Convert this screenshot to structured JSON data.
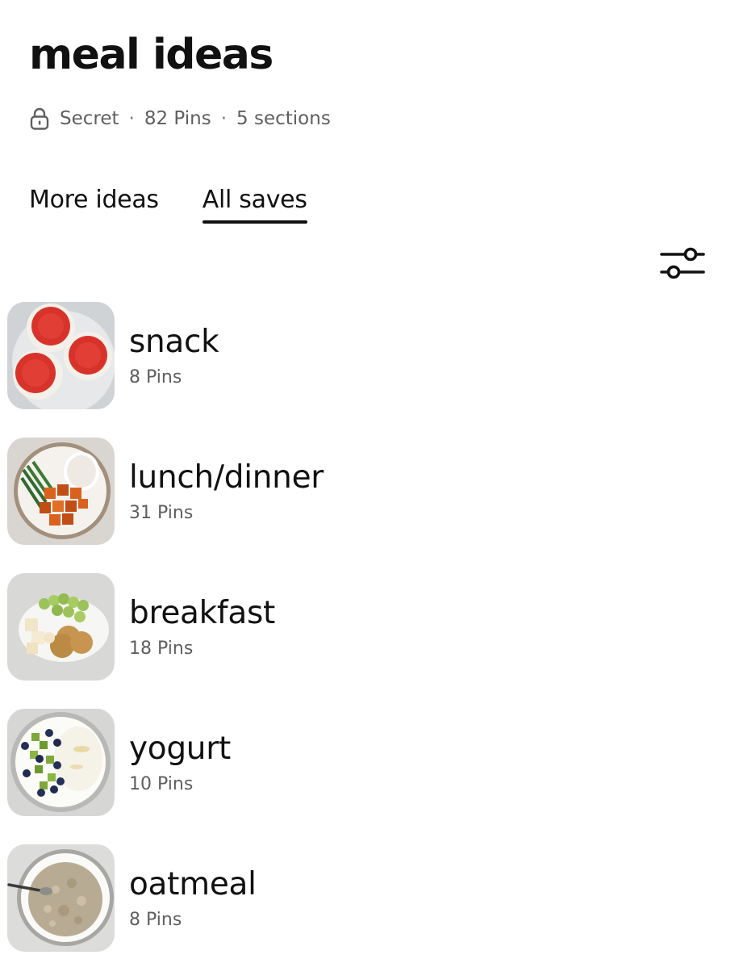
{
  "board": {
    "title": "meal ideas",
    "privacy_icon": "lock-icon",
    "privacy": "Secret",
    "pins": "82 Pins",
    "sections_count": "5 sections"
  },
  "tabs": [
    {
      "label": "More ideas",
      "active": false
    },
    {
      "label": "All saves",
      "active": true
    }
  ],
  "toolbar": {
    "filter_icon": "sliders-icon"
  },
  "sections": [
    {
      "name": "snack",
      "count": "8 Pins",
      "thumbnail": "tomato-rice-cakes-thumbnail"
    },
    {
      "name": "lunch/dinner",
      "count": "31 Pins",
      "thumbnail": "rice-tofu-greenbeans-thumbnail"
    },
    {
      "name": "breakfast",
      "count": "18 Pins",
      "thumbnail": "grapes-crackers-cheese-thumbnail"
    },
    {
      "name": "yogurt",
      "count": "10 Pins",
      "thumbnail": "yogurt-kiwi-blueberries-thumbnail"
    },
    {
      "name": "oatmeal",
      "count": "8 Pins",
      "thumbnail": "oatmeal-bowl-thumbnail"
    }
  ],
  "colors": {
    "text_primary": "#111111",
    "text_secondary": "#5f5f5f",
    "background": "#ffffff"
  }
}
